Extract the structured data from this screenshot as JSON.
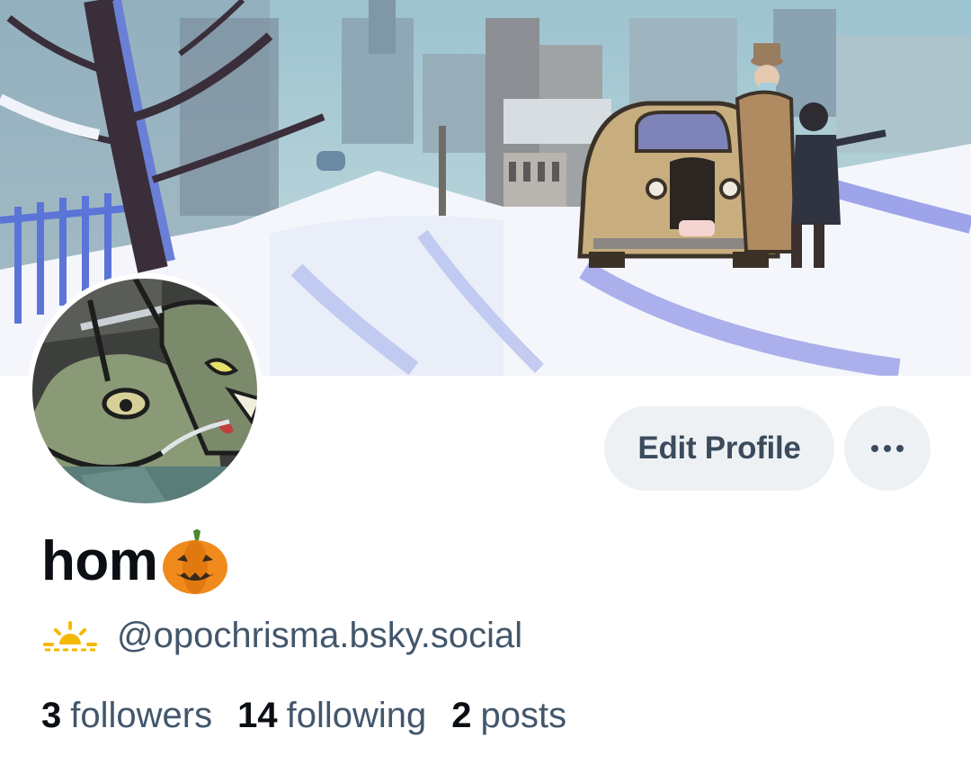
{
  "profile": {
    "display_name": "hom",
    "name_emoji": "pumpkin-icon",
    "handle_emoji": "sun-icon",
    "handle": "@opochrisma.bsky.social",
    "edit_button_label": "Edit Profile",
    "more_button_icon": "ellipsis-icon"
  },
  "stats": [
    {
      "value": "3",
      "label": "followers"
    },
    {
      "value": "14",
      "label": "following"
    },
    {
      "value": "2",
      "label": "posts"
    }
  ],
  "colors": {
    "button_bg": "#eef1f4",
    "button_text": "#3b4b5c",
    "name_text": "#0b0f14",
    "secondary_text": "#42576c",
    "pumpkin": "#f08a1c",
    "sun": "#f5b800"
  }
}
